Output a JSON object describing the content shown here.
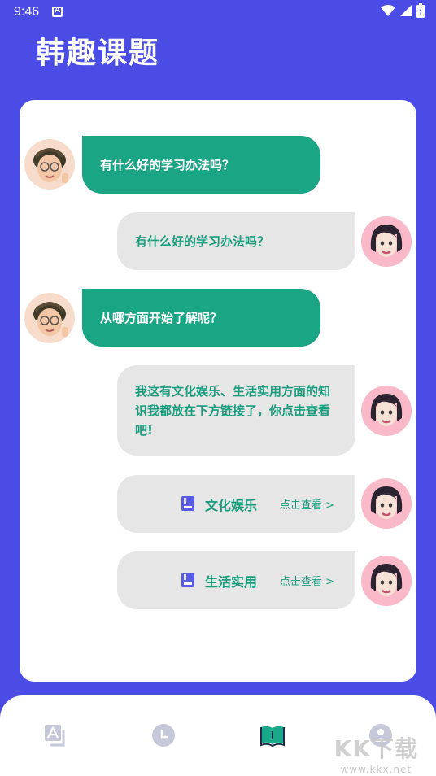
{
  "status": {
    "time": "9:46"
  },
  "app": {
    "title": "韩趣课题"
  },
  "chat": {
    "messages": [
      {
        "side": "left",
        "text": "有什么好的学习办法吗？"
      },
      {
        "side": "right",
        "text": "有什么好的学习办法吗？"
      },
      {
        "side": "left",
        "text": "从哪方面开始了解呢？"
      },
      {
        "side": "right",
        "text": "我这有文化娱乐、生活实用方面的知识我都放在下方链接了，你点击查看吧!"
      }
    ],
    "links": [
      {
        "label": "文化娱乐",
        "action": "点击查看 >"
      },
      {
        "label": "生活实用",
        "action": "点击查看 >"
      }
    ]
  },
  "nav": {
    "items": [
      "translate-icon",
      "clock-icon",
      "book-icon",
      "profile-icon"
    ],
    "active_index": 2
  },
  "watermark": {
    "main": "KK下载",
    "sub": "www.kkx.net"
  },
  "colors": {
    "background": "#4b4ce6",
    "green": "#1aa585",
    "bubble_gray": "#e6e6e6",
    "accent_text": "#1a9c7d",
    "book_icon": "#5a5ce8"
  }
}
